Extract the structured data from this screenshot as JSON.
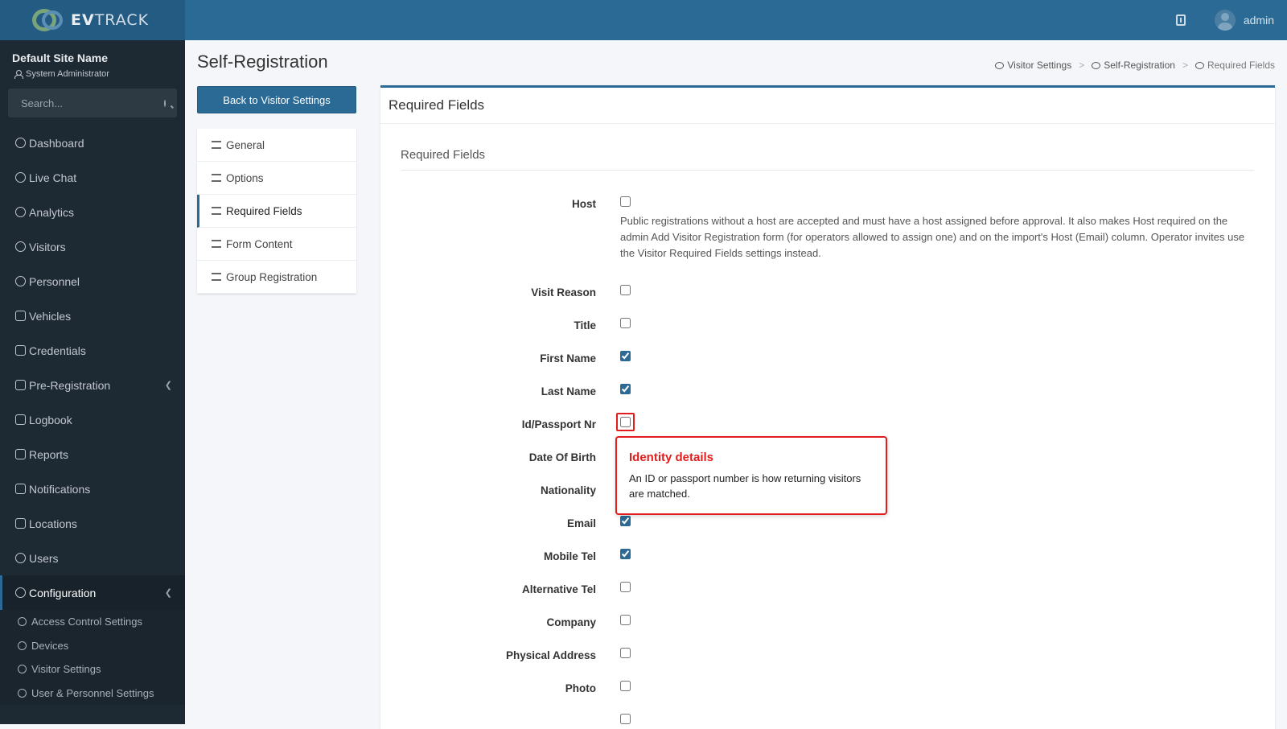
{
  "brand": {
    "name_bold": "EV",
    "name_rest": "TRACK"
  },
  "user": {
    "name": "admin"
  },
  "sidebar": {
    "site_name": "Default Site Name",
    "role": "System Administrator",
    "search_placeholder": "Search...",
    "items": [
      {
        "label": "Dashboard",
        "icon": "dashboard-icon"
      },
      {
        "label": "Live Chat",
        "icon": "headset-icon"
      },
      {
        "label": "Analytics",
        "icon": "analytics-icon"
      },
      {
        "label": "Visitors",
        "icon": "eye-icon"
      },
      {
        "label": "Personnel",
        "icon": "personnel-icon"
      },
      {
        "label": "Vehicles",
        "icon": "car-icon"
      },
      {
        "label": "Credentials",
        "icon": "badge-icon"
      },
      {
        "label": "Pre-Registration",
        "icon": "arrows-icon"
      },
      {
        "label": "Logbook",
        "icon": "book-icon"
      },
      {
        "label": "Reports",
        "icon": "reports-icon"
      },
      {
        "label": "Notifications",
        "icon": "chat-icon"
      },
      {
        "label": "Locations",
        "icon": "map-icon"
      },
      {
        "label": "Users",
        "icon": "users-icon"
      },
      {
        "label": "Configuration",
        "icon": "gear-icon"
      }
    ],
    "sub_items": [
      {
        "label": "Access Control Settings",
        "icon": "lock-icon"
      },
      {
        "label": "Devices",
        "icon": "cog-icon"
      },
      {
        "label": "Visitor Settings",
        "icon": "eye-icon"
      },
      {
        "label": "User & Personnel Settings",
        "icon": "user-cog-icon"
      }
    ]
  },
  "page": {
    "title": "Self-Registration"
  },
  "breadcrumb": [
    "Visitor Settings",
    "Self-Registration",
    "Required Fields"
  ],
  "back_button": "Back to Visitor Settings",
  "tabs": [
    {
      "label": "General"
    },
    {
      "label": "Options"
    },
    {
      "label": "Required Fields"
    },
    {
      "label": "Form Content"
    },
    {
      "label": "Group Registration"
    }
  ],
  "card": {
    "title": "Required Fields",
    "section_title": "Required Fields"
  },
  "host_help": "Public registrations without a host are accepted and must have a host assigned before approval. It also makes Host required on the admin Add Visitor Registration form (for operators allowed to assign one) and on the import's Host (Email) column. Operator invites use the Visitor Required Fields settings instead.",
  "fields": [
    {
      "label": "Host",
      "checked": false
    },
    {
      "label": "Visit Reason",
      "checked": false
    },
    {
      "label": "Title",
      "checked": false
    },
    {
      "label": "First Name",
      "checked": true
    },
    {
      "label": "Last Name",
      "checked": true
    },
    {
      "label": "Id/Passport Nr",
      "checked": false
    },
    {
      "label": "Date Of Birth",
      "checked": false
    },
    {
      "label": "Nationality",
      "checked": false
    },
    {
      "label": "Email",
      "checked": true
    },
    {
      "label": "Mobile Tel",
      "checked": true
    },
    {
      "label": "Alternative Tel",
      "checked": false
    },
    {
      "label": "Company",
      "checked": false
    },
    {
      "label": "Physical Address",
      "checked": false
    },
    {
      "label": "Photo",
      "checked": false
    }
  ],
  "callout": {
    "title": "Identity details",
    "body": "An ID or passport number is how returning visitors are matched."
  }
}
